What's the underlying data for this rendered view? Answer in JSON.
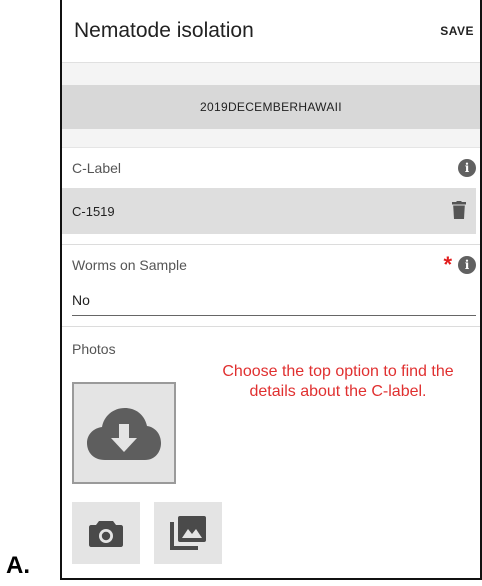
{
  "figure_label": "A.",
  "header": {
    "title": "Nematode isolation",
    "save_label": "SAVE"
  },
  "sample": {
    "name": "2019DECEMBERHAWAII"
  },
  "clabel": {
    "label": "C-Label",
    "value": "C-1519"
  },
  "worms": {
    "label": "Worms on Sample",
    "value": "No",
    "required_mark": "*"
  },
  "photos": {
    "label": "Photos"
  },
  "annotation": {
    "text": "Choose the top option to find the details about the C-label."
  },
  "icons": {
    "info": "info-icon",
    "delete": "trash-icon",
    "upload": "cloud-download-icon",
    "camera": "camera-icon",
    "gallery": "gallery-icon"
  },
  "colors": {
    "required": "#e21d1d",
    "annotation": "#e03030",
    "icon": "#616161"
  }
}
